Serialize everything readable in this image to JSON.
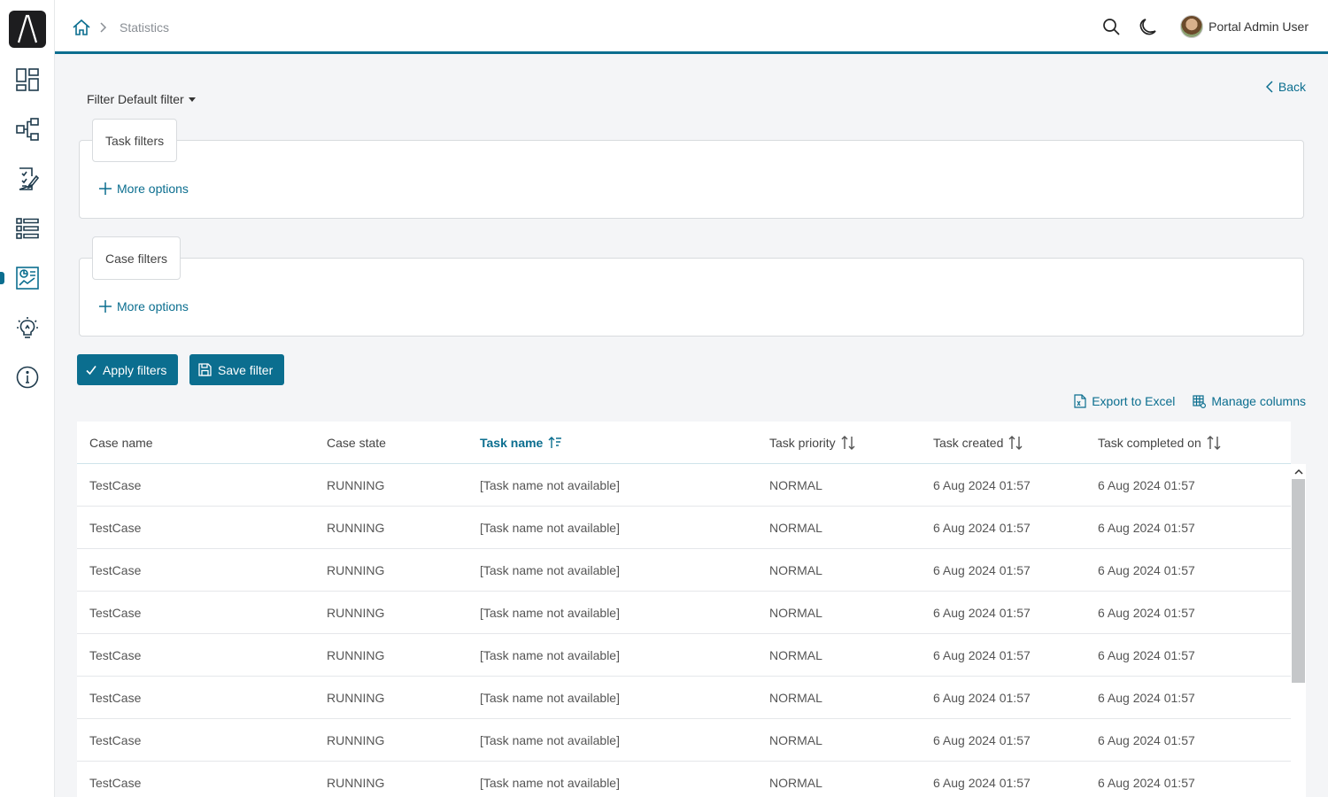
{
  "breadcrumb": {
    "current": "Statistics"
  },
  "user": {
    "name": "Portal Admin User"
  },
  "filter": {
    "title": "Filter Default filter"
  },
  "back_label": "Back",
  "task_filters": {
    "legend": "Task filters",
    "more_options": "More options"
  },
  "case_filters": {
    "legend": "Case filters",
    "more_options": "More options"
  },
  "buttons": {
    "apply": "Apply filters",
    "save": "Save filter"
  },
  "table_actions": {
    "export": "Export to Excel",
    "manage": "Manage columns"
  },
  "table": {
    "headers": {
      "case_name": "Case name",
      "case_state": "Case state",
      "task_name": "Task name",
      "task_priority": "Task priority",
      "task_created": "Task created",
      "task_completed": "Task completed on"
    },
    "rows": [
      {
        "case_name": "TestCase",
        "case_state": "RUNNING",
        "task_name": "[Task name not available]",
        "task_priority": "NORMAL",
        "task_created": "6 Aug 2024 01:57",
        "task_completed": "6 Aug 2024 01:57"
      },
      {
        "case_name": "TestCase",
        "case_state": "RUNNING",
        "task_name": "[Task name not available]",
        "task_priority": "NORMAL",
        "task_created": "6 Aug 2024 01:57",
        "task_completed": "6 Aug 2024 01:57"
      },
      {
        "case_name": "TestCase",
        "case_state": "RUNNING",
        "task_name": "[Task name not available]",
        "task_priority": "NORMAL",
        "task_created": "6 Aug 2024 01:57",
        "task_completed": "6 Aug 2024 01:57"
      },
      {
        "case_name": "TestCase",
        "case_state": "RUNNING",
        "task_name": "[Task name not available]",
        "task_priority": "NORMAL",
        "task_created": "6 Aug 2024 01:57",
        "task_completed": "6 Aug 2024 01:57"
      },
      {
        "case_name": "TestCase",
        "case_state": "RUNNING",
        "task_name": "[Task name not available]",
        "task_priority": "NORMAL",
        "task_created": "6 Aug 2024 01:57",
        "task_completed": "6 Aug 2024 01:57"
      },
      {
        "case_name": "TestCase",
        "case_state": "RUNNING",
        "task_name": "[Task name not available]",
        "task_priority": "NORMAL",
        "task_created": "6 Aug 2024 01:57",
        "task_completed": "6 Aug 2024 01:57"
      },
      {
        "case_name": "TestCase",
        "case_state": "RUNNING",
        "task_name": "[Task name not available]",
        "task_priority": "NORMAL",
        "task_created": "6 Aug 2024 01:57",
        "task_completed": "6 Aug 2024 01:57"
      },
      {
        "case_name": "TestCase",
        "case_state": "RUNNING",
        "task_name": "[Task name not available]",
        "task_priority": "NORMAL",
        "task_created": "6 Aug 2024 01:57",
        "task_completed": "6 Aug 2024 01:57"
      }
    ]
  },
  "colors": {
    "accent": "#0b6e8f",
    "background": "#f4f5f7"
  }
}
